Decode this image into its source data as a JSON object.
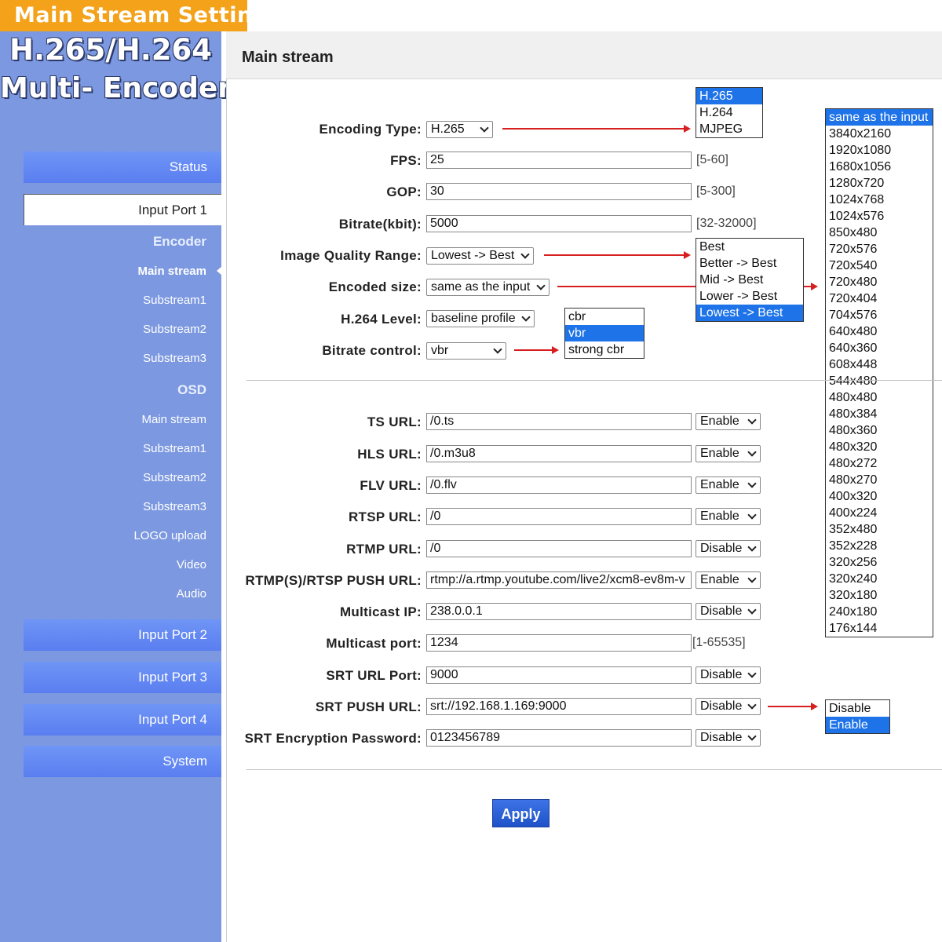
{
  "banner": "Main Stream Setting",
  "brand": {
    "line1": "H.265/H.264",
    "line2": "Multi- Encoder"
  },
  "nav": {
    "status": "Status",
    "input_port_1": "Input Port 1",
    "encoder_head": "Encoder",
    "encoder_items": [
      "Main stream",
      "Substream1",
      "Substream2",
      "Substream3"
    ],
    "osd_head": "OSD",
    "osd_items": [
      "Main stream",
      "Substream1",
      "Substream2",
      "Substream3"
    ],
    "logo_upload": "LOGO upload",
    "video": "Video",
    "audio": "Audio",
    "input_port_2": "Input Port 2",
    "input_port_3": "Input Port 3",
    "input_port_4": "Input Port 4",
    "system": "System"
  },
  "page_title": "Main stream",
  "encoding": {
    "encoding_type": {
      "label": "Encoding Type:",
      "value": "H.265"
    },
    "fps": {
      "label": "FPS:",
      "value": "25",
      "range": "[5-60]"
    },
    "gop": {
      "label": "GOP:",
      "value": "30",
      "range": "[5-300]"
    },
    "bitrate": {
      "label": "Bitrate(kbit):",
      "value": "5000",
      "range": "[32-32000]"
    },
    "image_quality": {
      "label": "Image Quality Range:",
      "value": "Lowest -> Best"
    },
    "encoded_size": {
      "label": "Encoded size:",
      "value": "same as the input"
    },
    "h264_level": {
      "label": "H.264 Level:",
      "value": "baseline profile"
    },
    "bitrate_control": {
      "label": "Bitrate control:",
      "value": "vbr"
    }
  },
  "dropdowns": {
    "encoding_type_options": [
      "H.265",
      "H.264",
      "MJPEG"
    ],
    "quality_options": [
      "Best",
      "Better -> Best",
      "Mid -> Best",
      "Lower -> Best",
      "Lowest -> Best"
    ],
    "bitrate_control_options": [
      "cbr",
      "vbr",
      "strong cbr"
    ],
    "size_options": [
      "same as the input",
      "3840x2160",
      "1920x1080",
      "1680x1056",
      "1280x720",
      "1024x768",
      "1024x576",
      "850x480",
      "720x576",
      "720x540",
      "720x480",
      "720x404",
      "704x576",
      "640x480",
      "640x360",
      "608x448",
      "544x480",
      "480x480",
      "480x384",
      "480x360",
      "480x320",
      "480x272",
      "480x270",
      "400x320",
      "400x224",
      "352x480",
      "352x228",
      "320x256",
      "320x240",
      "320x180",
      "240x180",
      "176x144"
    ],
    "enable_options": [
      "Disable",
      "Enable"
    ]
  },
  "urls": {
    "ts": {
      "label": "TS URL:",
      "value": "/0.ts",
      "state": "Enable"
    },
    "hls": {
      "label": "HLS URL:",
      "value": "/0.m3u8",
      "state": "Enable"
    },
    "flv": {
      "label": "FLV URL:",
      "value": "/0.flv",
      "state": "Enable"
    },
    "rtsp": {
      "label": "RTSP URL:",
      "value": "/0",
      "state": "Enable"
    },
    "rtmp": {
      "label": "RTMP URL:",
      "value": "/0",
      "state": "Disable"
    },
    "push": {
      "label": "RTMP(S)/RTSP PUSH URL:",
      "value": "rtmp://a.rtmp.youtube.com/live2/xcm8-ev8m-v",
      "state": "Enable"
    },
    "multicast_ip": {
      "label": "Multicast IP:",
      "value": "238.0.0.1",
      "state": "Disable"
    },
    "multicast_port": {
      "label": "Multicast port:",
      "value": "1234",
      "range": "[1-65535]"
    },
    "srt_port": {
      "label": "SRT URL Port:",
      "value": "9000",
      "state": "Disable"
    },
    "srt_push": {
      "label": "SRT PUSH URL:",
      "value": "srt://192.168.1.169:9000",
      "state": "Disable"
    },
    "srt_password": {
      "label": "SRT Encryption Password:",
      "value": "0123456789",
      "state": "Disable"
    }
  },
  "apply_label": "Apply",
  "colors": {
    "sidebar": "#7c98e0",
    "banner": "#f3a21a",
    "highlight": "#1e73e8",
    "arrow": "#d71f1f",
    "apply": "#2a5fd8"
  }
}
